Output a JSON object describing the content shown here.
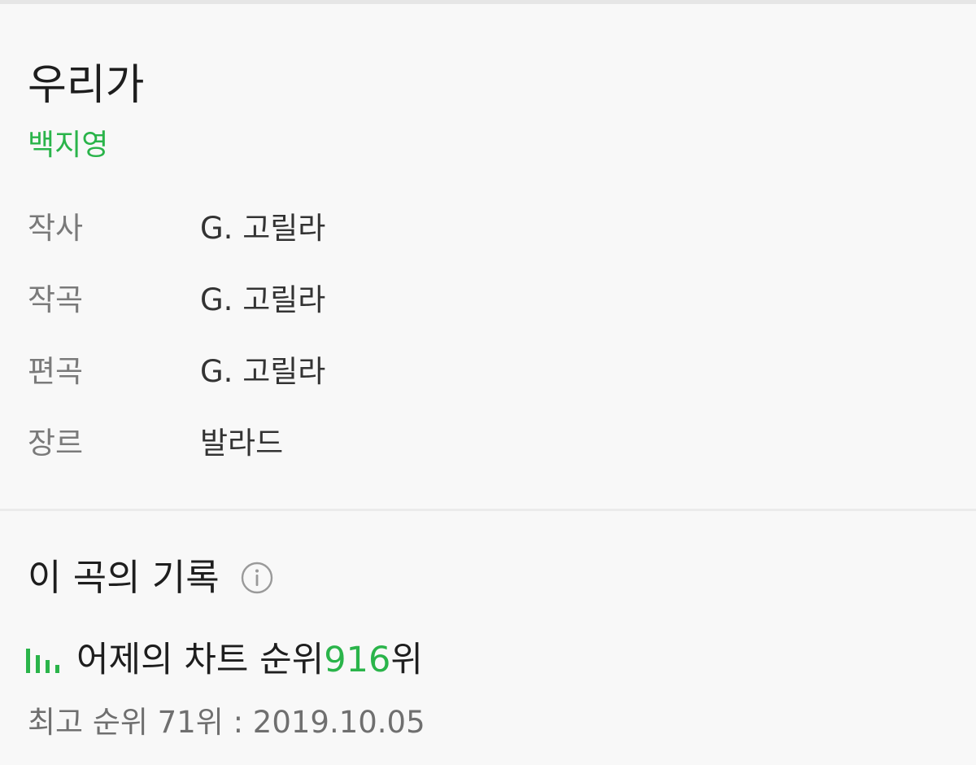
{
  "song": {
    "title": "우리가",
    "artist": "백지영"
  },
  "credits": [
    {
      "label": "작사",
      "value": "G. 고릴라"
    },
    {
      "label": "작곡",
      "value": "G. 고릴라"
    },
    {
      "label": "편곡",
      "value": "G. 고릴라"
    },
    {
      "label": "장르",
      "value": "발라드"
    }
  ],
  "record": {
    "title": "이 곡의 기록",
    "info_icon": "info-circle-icon",
    "chart_icon": "bar-chart-icon",
    "chart_prefix": "어제의 차트 순위 ",
    "chart_rank": "916",
    "chart_suffix": "위",
    "best_rank": "최고 순위 71위 : 2019.10.05"
  },
  "colors": {
    "accent": "#2ab44a",
    "background": "#f8f8f8",
    "label_gray": "#7a7a7a",
    "divider": "#ebebeb"
  }
}
